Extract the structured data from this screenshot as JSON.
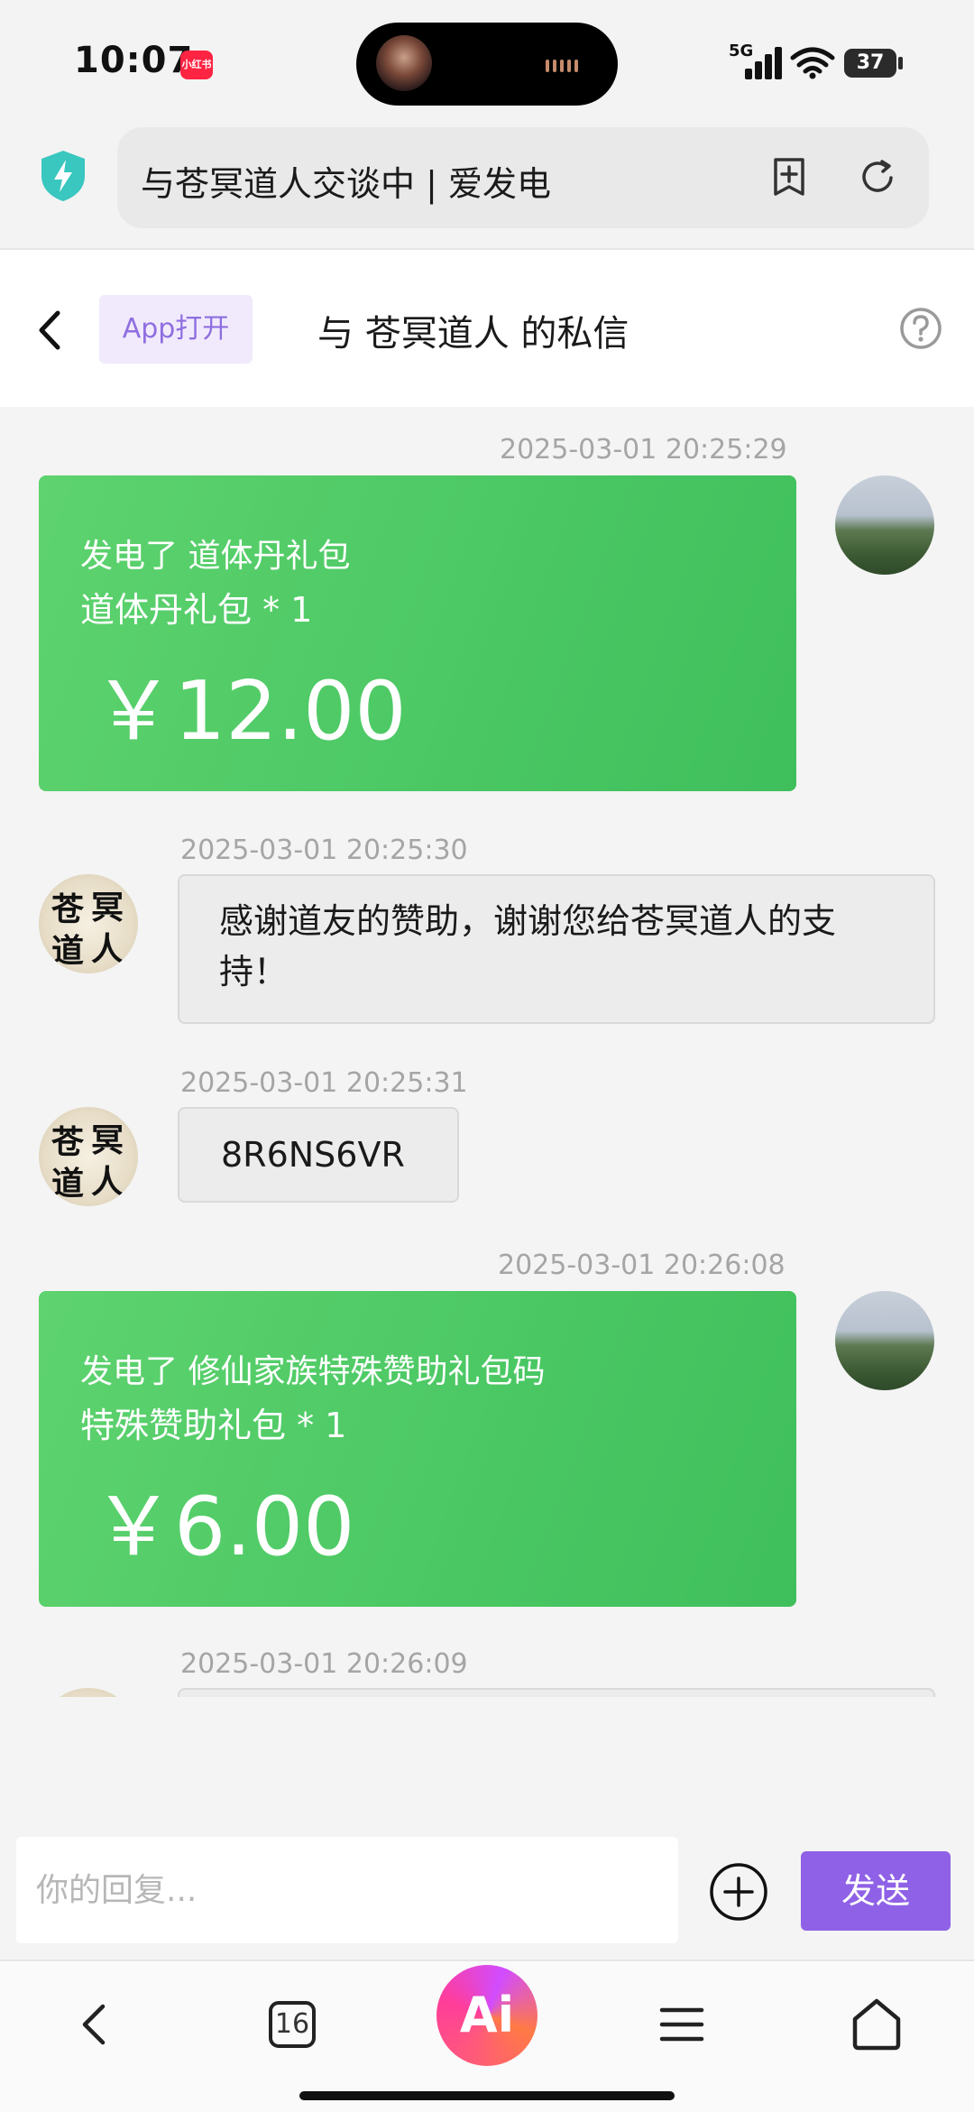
{
  "status_bar": {
    "time": "10:07",
    "app_badge": "小红书",
    "network": "5G",
    "battery": "37"
  },
  "browser": {
    "url_title": "与苍冥道人交谈中 | 爱发电"
  },
  "header": {
    "app_open_label": "App打开",
    "title": "与 苍冥道人 的私信"
  },
  "messages": [
    {
      "timestamp": "2025-03-01 20:25:29",
      "line1": "发电了 道体丹礼包",
      "line2": "道体丹礼包 * 1",
      "price": "￥12.00"
    },
    {
      "timestamp": "2025-03-01 20:25:30",
      "text": "感谢道友的赞助，谢谢您给苍冥道人的支持！"
    },
    {
      "timestamp": "2025-03-01 20:25:31",
      "text": "8R6NS6VR"
    },
    {
      "timestamp": "2025-03-01 20:26:08",
      "line1": "发电了 修仙家族特殊赞助礼包码",
      "line2": "特殊赞助礼包 * 1",
      "price": "￥6.00"
    },
    {
      "timestamp": "2025-03-01 20:26:09"
    }
  ],
  "creator_avatar_text": "苍冥道人",
  "reply": {
    "placeholder": "你的回复...",
    "send_label": "发送"
  },
  "bottom_nav": {
    "tab_count": "16",
    "ai_label": "Ai"
  }
}
